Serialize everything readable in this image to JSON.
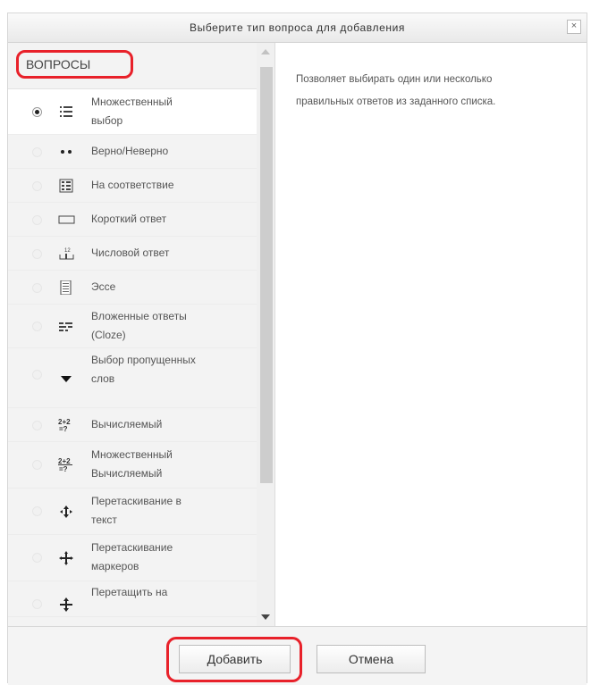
{
  "dialog": {
    "title": "Выберите тип вопроса для добавления",
    "close_label": "×"
  },
  "left_panel": {
    "section_label": "ВОПРОСЫ",
    "options": [
      {
        "label_lines": [
          "Множественный",
          "выбор"
        ],
        "icon": "multichoice-list-icon",
        "selected": true
      },
      {
        "label_lines": [
          "Верно/Неверно"
        ],
        "icon": "true-false-dots-icon",
        "selected": false
      },
      {
        "label_lines": [
          "На соответствие"
        ],
        "icon": "matching-icon",
        "selected": false
      },
      {
        "label_lines": [
          "Короткий ответ"
        ],
        "icon": "short-answer-icon",
        "selected": false
      },
      {
        "label_lines": [
          "Числовой ответ"
        ],
        "icon": "numerical-icon",
        "selected": false
      },
      {
        "label_lines": [
          "Эссе"
        ],
        "icon": "essay-icon",
        "selected": false
      },
      {
        "label_lines": [
          "Вложенные ответы",
          "(Cloze)"
        ],
        "icon": "cloze-icon",
        "selected": false
      },
      {
        "label_lines": [
          "Выбор пропущенных",
          "слов"
        ],
        "icon": "select-missing-words-icon",
        "selected": false
      },
      {
        "label_lines": [
          "Вычисляемый"
        ],
        "icon": "calculated-icon",
        "selected": false
      },
      {
        "label_lines": [
          "Множественный",
          "Вычисляемый"
        ],
        "icon": "calculated-multi-icon",
        "selected": false
      },
      {
        "label_lines": [
          "Перетаскивание в",
          "текст"
        ],
        "icon": "drag-drop-text-icon",
        "selected": false
      },
      {
        "label_lines": [
          "Перетаскивание",
          "маркеров"
        ],
        "icon": "drag-drop-markers-icon",
        "selected": false
      },
      {
        "label_lines": [
          "Перетащить на"
        ],
        "icon": "drag-drop-image-icon",
        "selected": false
      }
    ]
  },
  "description": {
    "lines": [
      "Позволяет выбирать один или несколько",
      "правильных ответов из заданного списка."
    ]
  },
  "footer": {
    "add_label": "Добавить",
    "cancel_label": "Отмена"
  },
  "colors": {
    "highlight": "#e8212a",
    "panel_bg": "#f3f3f3",
    "selected_bg": "#ffffff"
  }
}
